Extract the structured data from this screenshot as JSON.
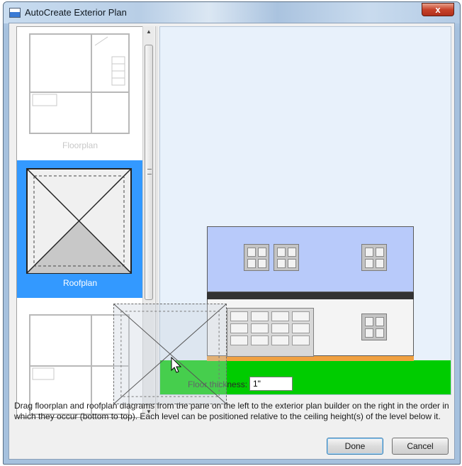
{
  "window": {
    "title": "AutoCreate Exterior Plan",
    "close_label": "x"
  },
  "list": {
    "items": [
      {
        "label": "Floorplan"
      },
      {
        "label": "Roofplan"
      },
      {
        "label": ""
      }
    ],
    "selected": "Roofplan"
  },
  "canvas": {
    "ground_color": "#00cc00",
    "upper_color": "#b8cafa",
    "band_color": "#333333",
    "base_color": "#f0a040"
  },
  "floor": {
    "label": "Floor thickness:",
    "value": "1\""
  },
  "hint": "Drag floorplan and roofplan diagrams from the pane on the left to the exterior plan builder on the right in the order in which they occur (bottom to top). Each level can be positioned relative to the ceiling height(s) of the level below it.",
  "buttons": {
    "done": "Done",
    "cancel": "Cancel"
  }
}
